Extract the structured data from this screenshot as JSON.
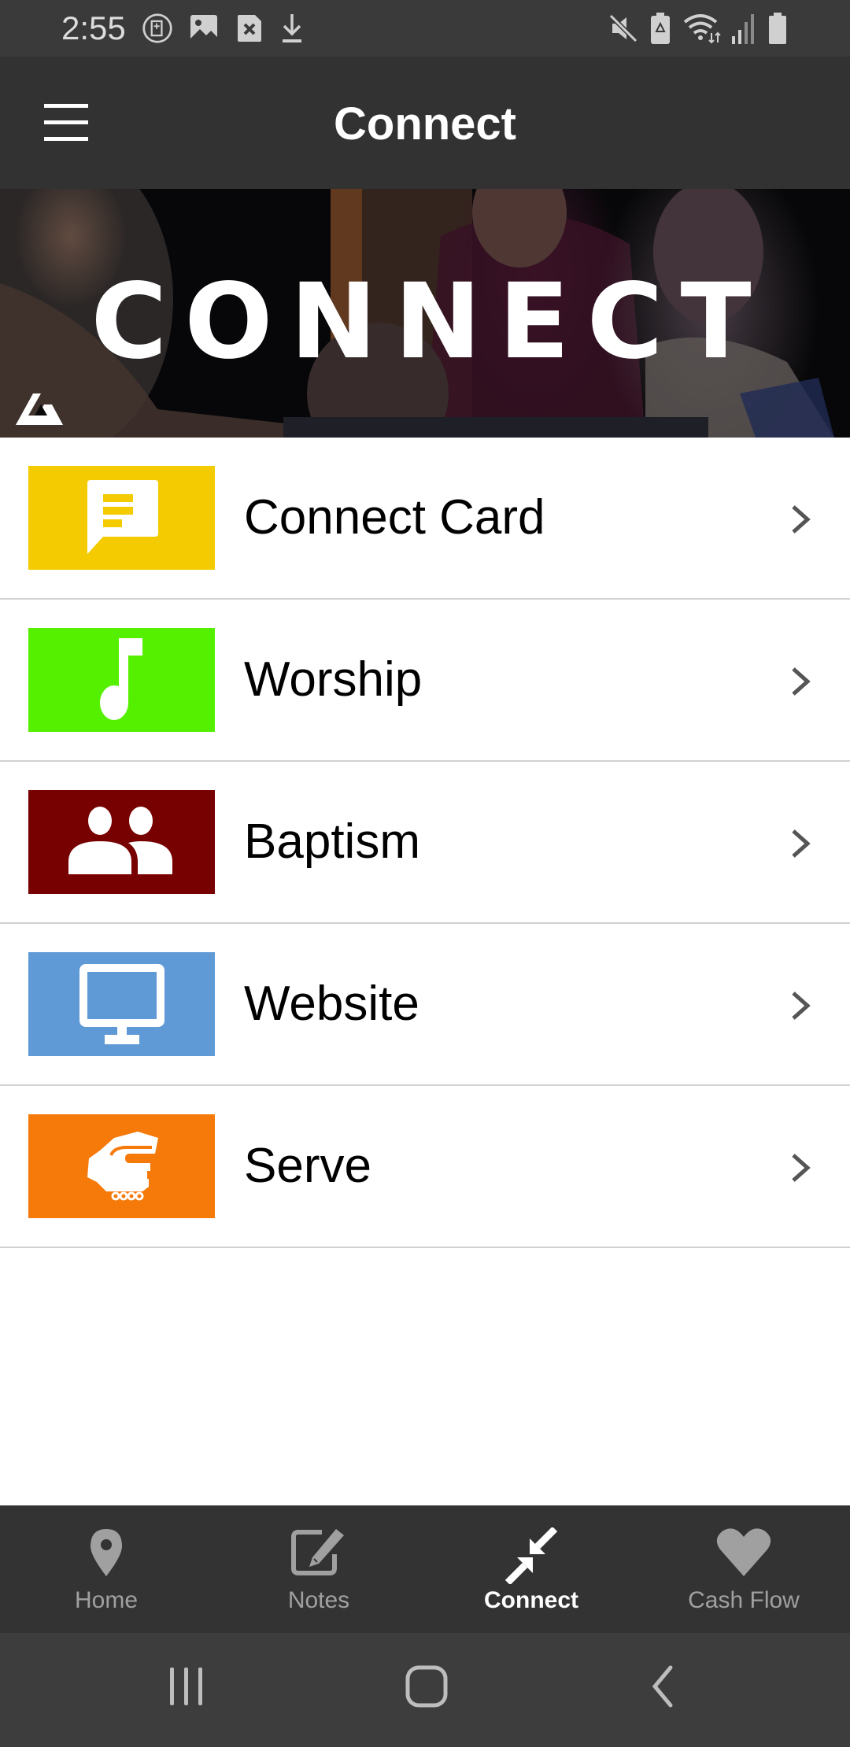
{
  "status_bar": {
    "time": "2:55",
    "left_icons": [
      "bible-app-icon",
      "image-icon",
      "sim-error-icon",
      "download-icon"
    ],
    "right_icons": [
      "mute-icon",
      "battery-saver-icon",
      "wifi-icon",
      "signal-icon",
      "battery-icon"
    ]
  },
  "app_bar": {
    "title": "Connect",
    "menu_icon": "hamburger-menu-icon"
  },
  "banner": {
    "headline": "CONNECT",
    "logo": "church-logo"
  },
  "list": {
    "items": [
      {
        "label": "Connect Card",
        "icon": "chat-note-icon",
        "color": "#F4CB00"
      },
      {
        "label": "Worship",
        "icon": "music-note-icon",
        "color": "#55F000"
      },
      {
        "label": "Baptism",
        "icon": "people-icon",
        "color": "#770000"
      },
      {
        "label": "Website",
        "icon": "monitor-icon",
        "color": "#5F9AD6"
      },
      {
        "label": "Serve",
        "icon": "handshake-icon",
        "color": "#F57A0A"
      }
    ]
  },
  "bottom_nav": {
    "tabs": [
      {
        "label": "Home",
        "icon": "map-pin-icon",
        "active": false
      },
      {
        "label": "Notes",
        "icon": "edit-note-icon",
        "active": false
      },
      {
        "label": "Connect",
        "icon": "compress-arrows-icon",
        "active": true
      },
      {
        "label": "Cash Flow",
        "icon": "heart-icon",
        "active": false
      }
    ]
  },
  "system_nav": {
    "buttons": [
      "recents-button",
      "home-button",
      "back-button"
    ]
  },
  "colors": {
    "app_bar": "#323232",
    "status_bar": "#3a3a3a",
    "bottom_nav": "#333333",
    "system_nav": "#3d3d3d",
    "nav_inactive": "#a0a0a0",
    "nav_active": "#ffffff"
  }
}
